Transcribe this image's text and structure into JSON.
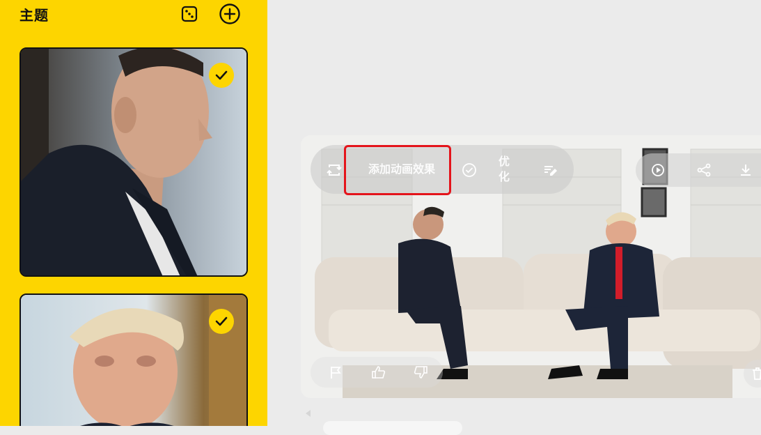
{
  "sidebar": {
    "title": "主题",
    "actions": [
      "dice-icon",
      "add-circle-icon"
    ],
    "subjects": [
      {
        "selected": true
      },
      {
        "selected": true
      }
    ]
  },
  "result": {
    "toolbar": {
      "animate_label": "添加动画效果",
      "optimize_label": "优化"
    },
    "actions_right": [
      "video-icon",
      "share-icon",
      "download-icon"
    ],
    "feedback": [
      "flag-icon",
      "thumbs-up-icon",
      "thumbs-down-icon"
    ],
    "delete_icon": "trash-icon"
  },
  "colors": {
    "accent": "#fdd500",
    "highlight": "#e4141b",
    "background": "#ebebeb"
  }
}
